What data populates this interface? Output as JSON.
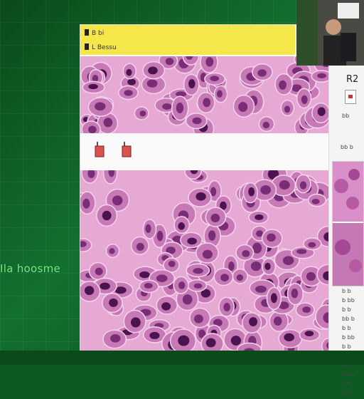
{
  "background": {
    "color": "#127030",
    "label_color": "#7ee37e"
  },
  "side_label": "Ila hoosme",
  "window": {
    "title_bar_color": "#f5e64a",
    "title_lines": [
      "B bi",
      "L Bessu"
    ],
    "tools": [
      {
        "icon": "red-marker-icon",
        "color": "#d9534f"
      },
      {
        "icon": "red-marker-icon",
        "color": "#d9534f"
      }
    ]
  },
  "tissue_colors": {
    "stroma": "#e6a9d4",
    "cytoplasm": "#c779b6",
    "nucleus": "#7a2d77",
    "dark_nucleus": "#4b1350"
  },
  "video": {
    "icon": "presenter-video-icon"
  },
  "right_panel": {
    "title": "R2",
    "subtitle": "bb",
    "heading": "bb b",
    "rows": [
      "b b",
      "b bb",
      "b b",
      "bb b",
      "b b",
      "b bb",
      "b b",
      "bb b",
      "b b",
      "b bb",
      "b b",
      "bb"
    ]
  }
}
